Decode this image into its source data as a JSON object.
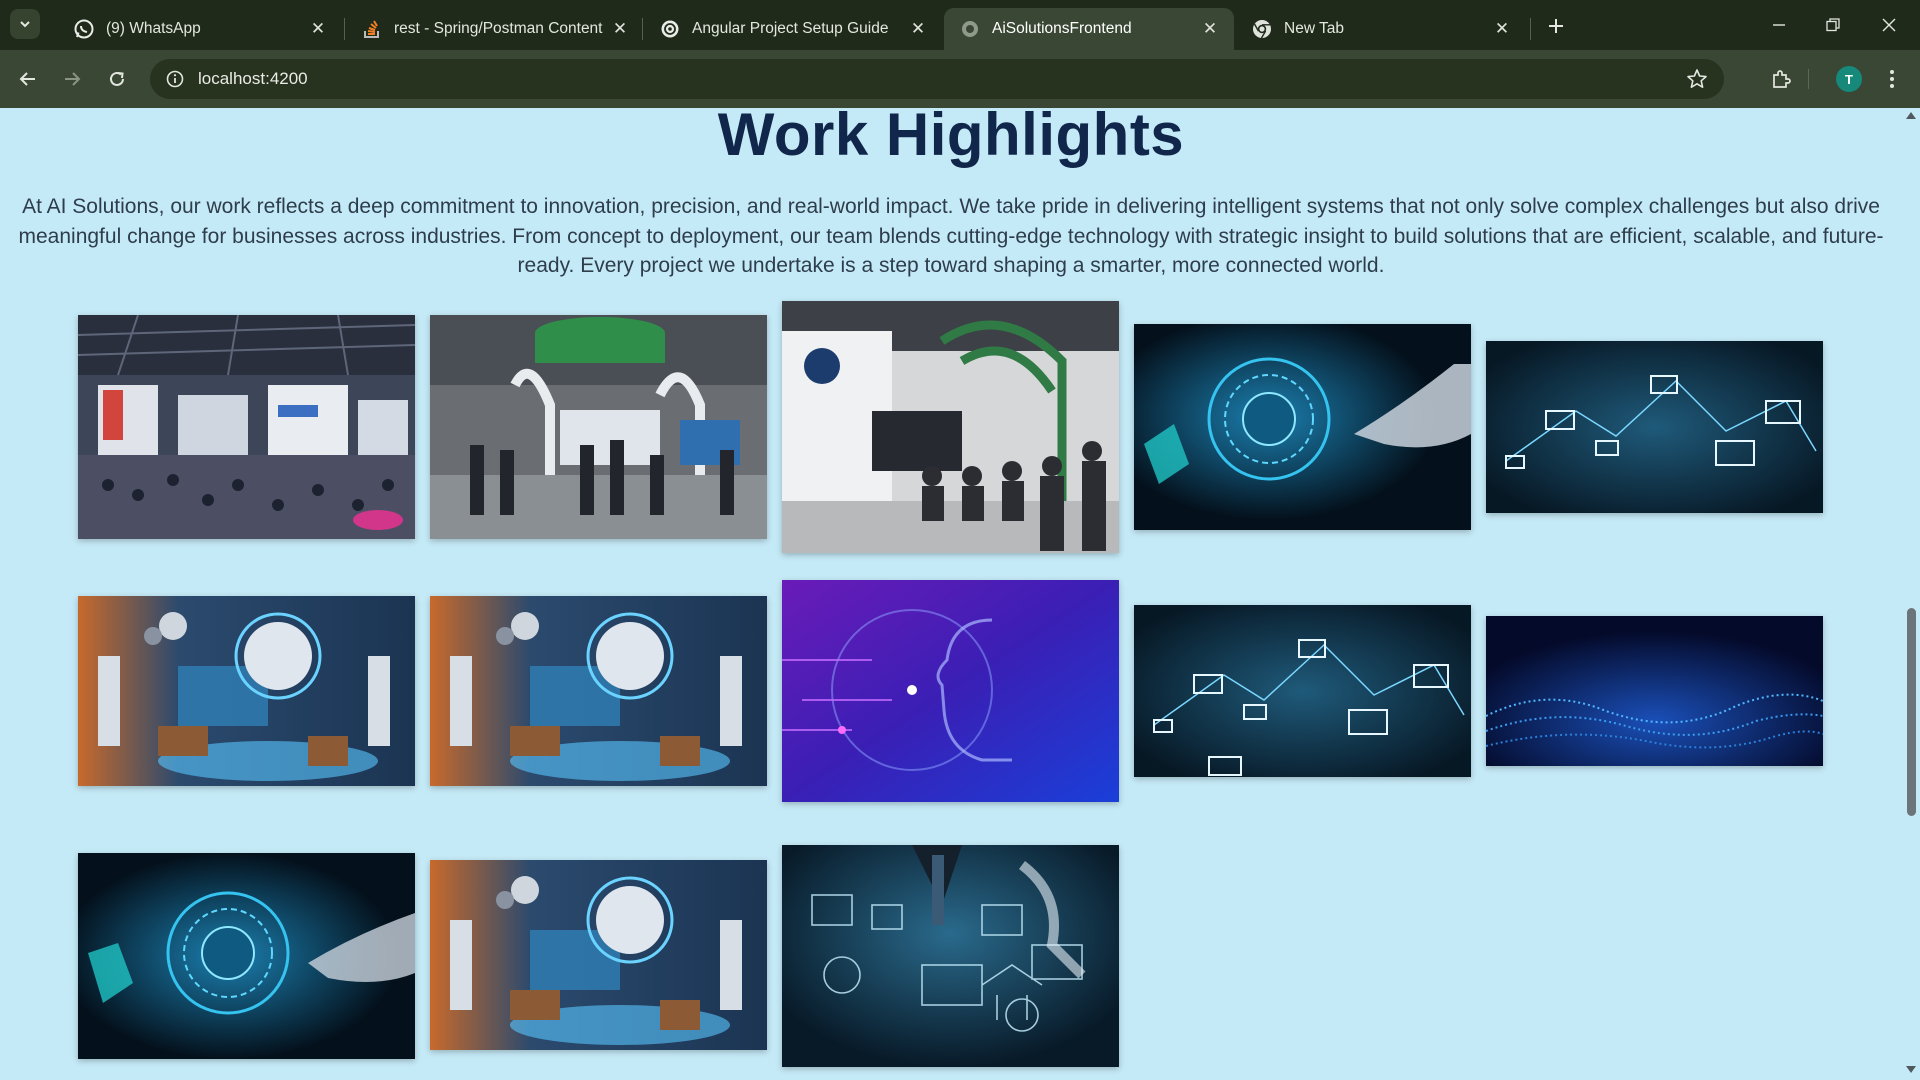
{
  "browser": {
    "tabs": [
      {
        "title": "(9) WhatsApp",
        "icon": "whatsapp-icon",
        "active": false
      },
      {
        "title": "rest - Spring/Postman Content",
        "icon": "stackoverflow-icon",
        "active": false
      },
      {
        "title": "Angular Project Setup Guide",
        "icon": "chatgpt-icon",
        "active": false
      },
      {
        "title": "AiSolutionsFrontend",
        "icon": "globe-icon",
        "active": true
      },
      {
        "title": "New Tab",
        "icon": "chrome-icon",
        "active": false
      }
    ],
    "url": "localhost:4200",
    "profile_initial": "T",
    "colors": {
      "tabstrip": "#1f2a1a",
      "toolbar": "#394734",
      "omnibox": "#27321f",
      "avatar": "#16897a"
    }
  },
  "page": {
    "heading": "Work Highlights",
    "intro": "At AI Solutions, our work reflects a deep commitment to innovation, precision, and real-world impact. We take pride in delivering intelligent systems that not only solve complex challenges but also drive meaningful change for businesses across industries. From concept to deployment, our team blends cutting-edge technology with strategic insight to build solutions that are efficient, scalable, and future-ready. Every project we undertake is a step toward shaping a smarter, more connected world.",
    "background": "#c5eaf7",
    "heading_color": "#10264a",
    "gallery": [
      {
        "subject": "expo-hall-crowd"
      },
      {
        "subject": "energy-booth-crowd"
      },
      {
        "subject": "energy-booth-seated-audience"
      },
      {
        "subject": "ai-brain-touch"
      },
      {
        "subject": "network-envelopes"
      },
      {
        "subject": "ai-robots-dynamic-landing-page"
      },
      {
        "subject": "ai-robots-dynamic-landing-page"
      },
      {
        "subject": "purple-digital-head"
      },
      {
        "subject": "network-envelopes"
      },
      {
        "subject": "particle-wave"
      },
      {
        "subject": "ai-brain-touch"
      },
      {
        "subject": "ai-robots-dynamic-landing-page"
      },
      {
        "subject": "businessman-digital-diagram"
      }
    ]
  }
}
